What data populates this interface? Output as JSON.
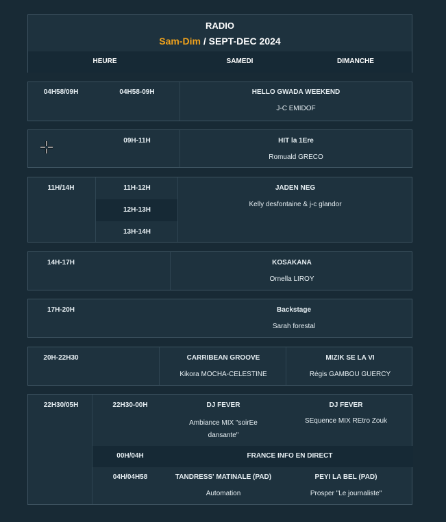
{
  "header": {
    "title": "RADIO",
    "subtitle_accent": "Sam-Dim",
    "subtitle_rest": " / SEPT-DEC 2024",
    "col_heure": "HEURE",
    "col_samedi": "SAMEDI",
    "col_dimanche": "DIMANCHE"
  },
  "blocks": [
    {
      "time": "04H58/09H",
      "slot": "04H58-09H",
      "show": "HELLO GWADA WEEKEND",
      "host": "J-C EMIDOF"
    },
    {
      "slot": "09H-11H",
      "show": "HIT la 1Ere",
      "host": "Romuald GRECO"
    },
    {
      "time": "11H/14H",
      "slots": [
        "11H-12H",
        "12H-13H",
        "13H-14H"
      ],
      "show": "JADEN NEG",
      "host": "Kelly desfontaine & j-c glandor"
    },
    {
      "time": "14H-17H",
      "show": "KOSAKANA",
      "host": "Ornella LIROY"
    },
    {
      "time": "17H-20H",
      "show": "Backstage",
      "host": "Sarah forestal"
    },
    {
      "time": "20H-22H30",
      "sat_show": "CARRIBEAN GROOVE",
      "sat_host": "Kikora MOCHA-CELESTINE",
      "sun_show": "MIZIK SE LA VI",
      "sun_host": "Régis GAMBOU GUERCY"
    },
    {
      "time": "22H30/05H",
      "row1": {
        "slot": "22H30-00H",
        "sat_show": "DJ FEVER",
        "sat_host": "Ambiance MIX \"soirEe dansante\"",
        "sun_show": "DJ FEVER",
        "sun_host": "SEquence MIX REtro Zouk"
      },
      "row2": {
        "slot": "00H/04H",
        "show": "FRANCE INFO EN DIRECT"
      },
      "row3": {
        "slot": "04H/04H58",
        "sat_show": "TANDRESS' MATINALE (PAD)",
        "sat_host": "Automation",
        "sun_show": "PEYI LA BEL (PAD)",
        "sun_host": "Prosper \"Le journaliste\""
      }
    }
  ]
}
